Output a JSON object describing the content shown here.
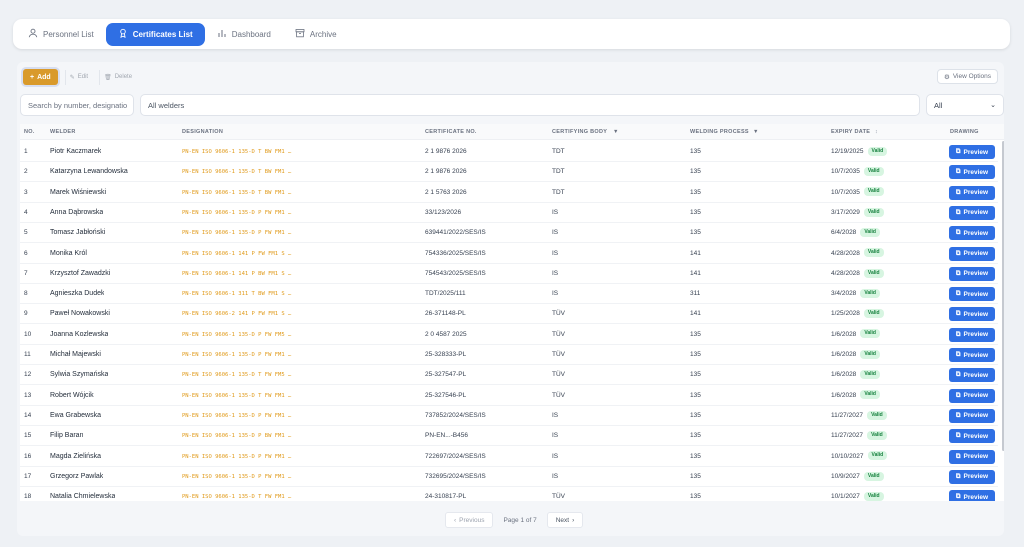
{
  "tabs": [
    {
      "label": "Personnel List",
      "icon": "user-icon"
    },
    {
      "label": "Certificates List",
      "icon": "certificate-icon",
      "active": true
    },
    {
      "label": "Dashboard",
      "icon": "chart-icon"
    },
    {
      "label": "Archive",
      "icon": "archive-icon"
    }
  ],
  "toolbar": {
    "add": "Add",
    "edit": "Edit",
    "delete": "Delete",
    "view_options": "View Options"
  },
  "filters": {
    "search_placeholder": "Search by number, designatio",
    "welder_filter": "All welders",
    "status_select": "All"
  },
  "columns": {
    "no": "NO.",
    "welder": "WELDER",
    "designation": "DESIGNATION",
    "cert_no": "CERTIFICATE NO.",
    "body": "CERTIFYING BODY",
    "process": "WELDING PROCESS",
    "expiry": "EXPIRY DATE",
    "drawing": "DRAWING"
  },
  "preview_label": "Preview",
  "rows": [
    {
      "no": "1",
      "welder": "Piotr Kaczmarek",
      "designation": "PN-EN ISO 9606-1 135-D T BW FM1 …",
      "cert": "2 1 9876 2026",
      "body": "TDT",
      "process": "135",
      "expiry": "12/19/2025",
      "status": "Valid"
    },
    {
      "no": "2",
      "welder": "Katarzyna Lewandowska",
      "designation": "PN-EN ISO 9606-1 135-D T BW FM1 …",
      "cert": "2 1 9876 2026",
      "body": "TDT",
      "process": "135",
      "expiry": "10/7/2035",
      "status": "Valid"
    },
    {
      "no": "3",
      "welder": "Marek Wiśniewski",
      "designation": "PN-EN ISO 9606-1 135-D T BW FM1 …",
      "cert": "2 1 5763 2026",
      "body": "TDT",
      "process": "135",
      "expiry": "10/7/2035",
      "status": "Valid"
    },
    {
      "no": "4",
      "welder": "Anna Dąbrowska",
      "designation": "PN-EN ISO 9606-1 135-D P FW FM1 …",
      "cert": "33/123/2026",
      "body": "IS",
      "process": "135",
      "expiry": "3/17/2029",
      "status": "Valid"
    },
    {
      "no": "5",
      "welder": "Tomasz Jabłoński",
      "designation": "PN-EN ISO 9606-1 135-D P FW FM1 …",
      "cert": "639441/2022/SES/IS",
      "body": "IS",
      "process": "135",
      "expiry": "6/4/2028",
      "status": "Valid"
    },
    {
      "no": "6",
      "welder": "Monika Król",
      "designation": "PN-EN ISO 9606-1 141 P FW FM1 S …",
      "cert": "754336/2025/SES/IS",
      "body": "IS",
      "process": "141",
      "expiry": "4/28/2028",
      "status": "Valid"
    },
    {
      "no": "7",
      "welder": "Krzysztof Zawadzki",
      "designation": "PN-EN ISO 9606-1 141 P BW FM1 S …",
      "cert": "754543/2025/SES/IS",
      "body": "IS",
      "process": "141",
      "expiry": "4/28/2028",
      "status": "Valid"
    },
    {
      "no": "8",
      "welder": "Agnieszka Dudek",
      "designation": "PN-EN ISO 9606-1 311 T BW FM1 S …",
      "cert": "TDT/2025/111",
      "body": "IS",
      "process": "311",
      "expiry": "3/4/2028",
      "status": "Valid"
    },
    {
      "no": "9",
      "welder": "Paweł Nowakowski",
      "designation": "PN-EN ISO 9606-2 141 P FW FM1 S …",
      "cert": "26-371148-PL",
      "body": "TÜV",
      "process": "141",
      "expiry": "1/25/2028",
      "status": "Valid"
    },
    {
      "no": "10",
      "welder": "Joanna Kozlewska",
      "designation": "PN-EN ISO 9606-1 135-D P FW FM5 …",
      "cert": "2 0 4587 2025",
      "body": "TÜV",
      "process": "135",
      "expiry": "1/6/2028",
      "status": "Valid"
    },
    {
      "no": "11",
      "welder": "Michał Majewski",
      "designation": "PN-EN ISO 9606-1 135-D P FW FM1 …",
      "cert": "25-328333-PL",
      "body": "TÜV",
      "process": "135",
      "expiry": "1/6/2028",
      "status": "Valid"
    },
    {
      "no": "12",
      "welder": "Sylwia Szymańska",
      "designation": "PN-EN ISO 9606-1 135-D T FW FM5 …",
      "cert": "25-327547-PL",
      "body": "TÜV",
      "process": "135",
      "expiry": "1/6/2028",
      "status": "Valid"
    },
    {
      "no": "13",
      "welder": "Robert Wójcik",
      "designation": "PN-EN ISO 9606-1 135-D T FW FM1 …",
      "cert": "25-327546-PL",
      "body": "TÜV",
      "process": "135",
      "expiry": "1/6/2028",
      "status": "Valid"
    },
    {
      "no": "14",
      "welder": "Ewa Grabewska",
      "designation": "PN-EN ISO 9606-1 135-D P FW FM1 …",
      "cert": "737852/2024/SES/IS",
      "body": "IS",
      "process": "135",
      "expiry": "11/27/2027",
      "status": "Valid"
    },
    {
      "no": "15",
      "welder": "Filip Baran",
      "designation": "PN-EN ISO 9606-1 135-D P BW FM1 …",
      "cert": "PN-EN...-B456",
      "body": "IS",
      "process": "135",
      "expiry": "11/27/2027",
      "status": "Valid"
    },
    {
      "no": "16",
      "welder": "Magda Zielińska",
      "designation": "PN-EN ISO 9606-1 135-D P FW FM1 …",
      "cert": "722697/2024/SES/IS",
      "body": "IS",
      "process": "135",
      "expiry": "10/10/2027",
      "status": "Valid"
    },
    {
      "no": "17",
      "welder": "Grzegorz Pawlak",
      "designation": "PN-EN ISO 9606-1 135-D P FW FM1 …",
      "cert": "732695/2024/SES/IS",
      "body": "IS",
      "process": "135",
      "expiry": "10/9/2027",
      "status": "Valid"
    },
    {
      "no": "18",
      "welder": "Natalia Chmielewska",
      "designation": "PN-EN ISO 9606-1 135-D T FW FM1 …",
      "cert": "24-310817-PL",
      "body": "TÜV",
      "process": "135",
      "expiry": "10/1/2027",
      "status": "Valid"
    }
  ],
  "pagination": {
    "previous": "Previous",
    "page_label": "Page 1 of 7",
    "next": "Next"
  }
}
